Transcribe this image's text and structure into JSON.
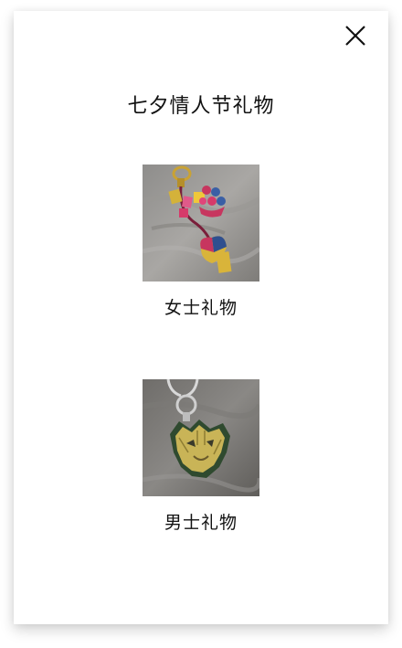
{
  "modal": {
    "title": "七夕情人节礼物",
    "close_icon": "close-icon"
  },
  "gifts": [
    {
      "label": "女士礼物",
      "image": "women-gift-charm-image"
    },
    {
      "label": "男士礼物",
      "image": "men-gift-charm-image"
    }
  ],
  "colors": {
    "background": "#ffffff",
    "text": "#111111"
  }
}
